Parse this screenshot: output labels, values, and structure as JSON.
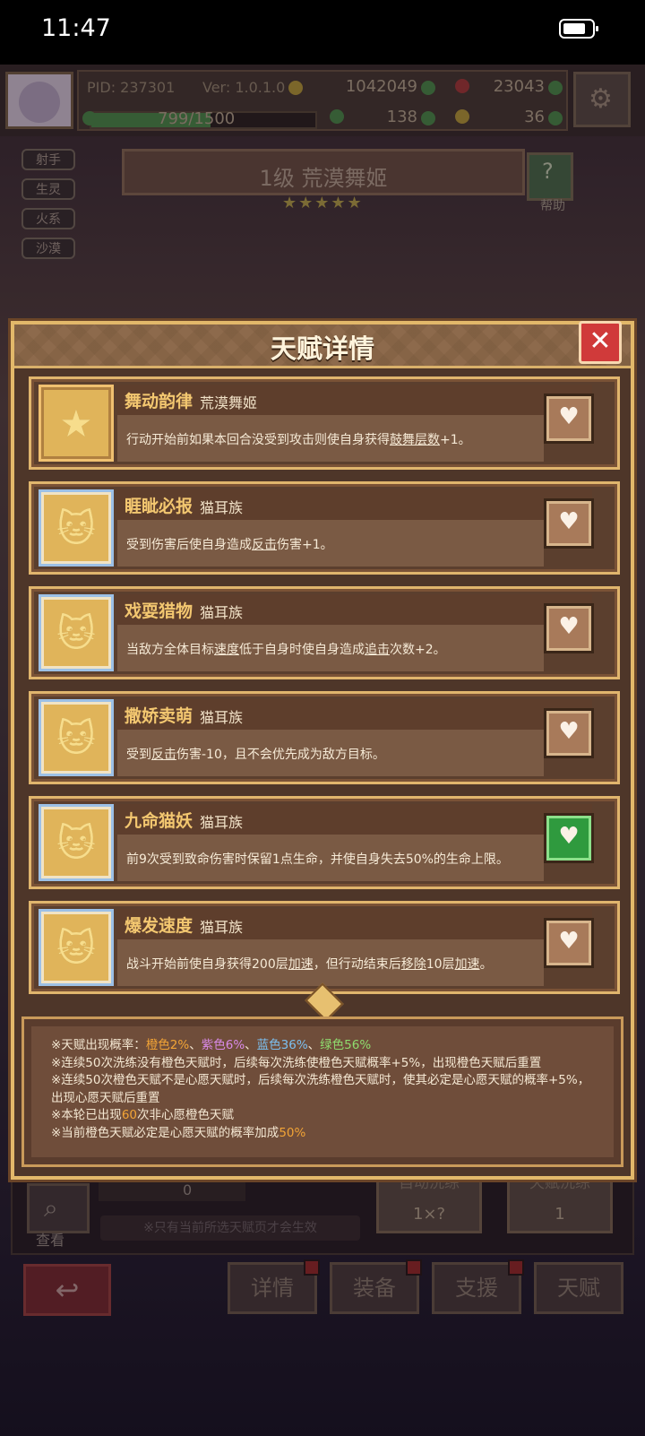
{
  "status": {
    "time": "11:47"
  },
  "hud": {
    "pid": "PID: 237301",
    "version": "Ver: 1.0.1.0",
    "gold": "1042049",
    "gem": "23043",
    "xp": "799/1500",
    "xp_progress": 0.533,
    "clover": "138",
    "potion": "36"
  },
  "tags": [
    "射手",
    "生灵",
    "火系",
    "沙漠"
  ],
  "hero": {
    "title": "1级  荒漠舞姬",
    "help": "帮助",
    "stars": "★★★★★"
  },
  "modal": {
    "title": "天赋详情",
    "close": "✕",
    "talents": [
      {
        "name": "舞动韵律",
        "tribe": "荒漠舞姬",
        "frame": "orange",
        "icon": "star-icon",
        "glyph": "★",
        "wish": false,
        "desc": [
          "行动开始前如果本回合没受到攻击则使自身获得",
          {
            "u": "鼓舞层数"
          },
          "+1。"
        ]
      },
      {
        "name": "睚眦必报",
        "tribe": "猫耳族",
        "frame": "blue",
        "icon": "cat-icon",
        "glyph": "🐱",
        "wish": false,
        "desc": [
          "受到伤害后使自身造成",
          {
            "u": "反击"
          },
          "伤害+1。"
        ]
      },
      {
        "name": "戏耍猎物",
        "tribe": "猫耳族",
        "frame": "blue",
        "icon": "cat-icon",
        "glyph": "🐱",
        "wish": false,
        "desc": [
          "当敌方全体目标",
          {
            "u": "速度"
          },
          "低于自身时使自身造成",
          {
            "u": "追击"
          },
          "次数+2。"
        ]
      },
      {
        "name": "撒娇卖萌",
        "tribe": "猫耳族",
        "frame": "blue",
        "icon": "cat-icon",
        "glyph": "🐱",
        "wish": false,
        "desc": [
          "受到",
          {
            "u": "反击"
          },
          "伤害-10，且不会优先成为敌方目标。"
        ]
      },
      {
        "name": "九命猫妖",
        "tribe": "猫耳族",
        "frame": "blue",
        "icon": "cat-icon",
        "glyph": "🐱",
        "wish": true,
        "desc": [
          "前9次受到致命伤害时保留1点生命，并使自身失去50%的生命上限。"
        ]
      },
      {
        "name": "爆发速度",
        "tribe": "猫耳族",
        "frame": "blue",
        "icon": "cat-icon",
        "glyph": "🐱",
        "wish": false,
        "desc": [
          "战斗开始前使自身获得200层",
          {
            "u": "加速"
          },
          "，但行动结束后",
          {
            "u": "移除"
          },
          "10层",
          {
            "u": "加速"
          },
          "。"
        ]
      }
    ],
    "notes": {
      "prob_label": "※天赋出现概率：",
      "orange": "橙色2%",
      "purple": "紫色6%",
      "blue": "蓝色36%",
      "green": "绿色56%",
      "sep": "、",
      "line2": "※连续50次洗练没有橙色天赋时，后续每次洗练使橙色天赋概率+5%，出现橙色天赋后重置",
      "line3": "※连续50次橙色天赋不是心愿天赋时，后续每次洗练橙色天赋时，使其必定是心愿天赋的概率+5%，出现心愿天赋后重置",
      "line4_pre": "※本轮已出现",
      "line4_num": "60",
      "line4_post": "次非心愿橙色天赋",
      "line5_pre": "※当前橙色天赋必定是心愿天赋的概率加成",
      "line5_num": "50%"
    }
  },
  "bottom": {
    "view": "查看",
    "count": "0",
    "tip": "※只有当前所选天赋页才会生效",
    "wash_auto": "自动洗练",
    "wash_auto_cost": "1×?",
    "wash_talent": "天赋洗练",
    "wash_talent_cost": "1",
    "nav": [
      "详情",
      "装备",
      "支援",
      "天赋"
    ],
    "back_icon": "↩"
  },
  "colors": {
    "accent": "#e2b86a",
    "close_red": "#d03a3a",
    "wish_green": "#2f9a3e"
  }
}
